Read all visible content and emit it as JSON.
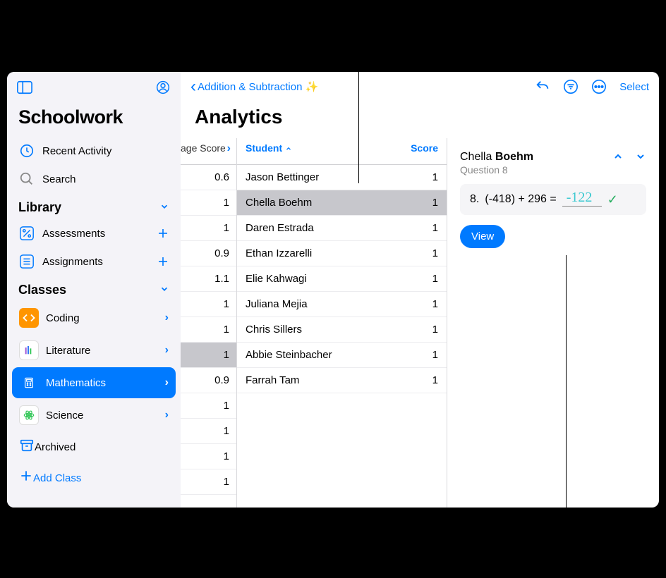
{
  "sidebar": {
    "title": "Schoolwork",
    "recent": "Recent Activity",
    "search": "Search",
    "library_header": "Library",
    "assessments": "Assessments",
    "assignments": "Assignments",
    "classes_header": "Classes",
    "classes": {
      "coding": "Coding",
      "literature": "Literature",
      "mathematics": "Mathematics",
      "science": "Science",
      "archived": "Archived"
    },
    "add_class": "Add Class"
  },
  "toolbar": {
    "back_label": "Addition & Subtraction ✨",
    "select": "Select"
  },
  "main": {
    "title": "Analytics"
  },
  "avg": {
    "header": "age Score",
    "values": [
      "0.6",
      "1",
      "1",
      "0.9",
      "1.1",
      "1",
      "1",
      "1",
      "0.9",
      "1",
      "1",
      "1",
      "1"
    ]
  },
  "students": {
    "header_left": "Student",
    "header_right": "Score",
    "list": [
      {
        "name": "Jason Bettinger",
        "score": "1"
      },
      {
        "name": "Chella Boehm",
        "score": "1"
      },
      {
        "name": "Daren Estrada",
        "score": "1"
      },
      {
        "name": "Ethan Izzarelli",
        "score": "1"
      },
      {
        "name": "Elie Kahwagi",
        "score": "1"
      },
      {
        "name": "Juliana Mejia",
        "score": "1"
      },
      {
        "name": "Chris Sillers",
        "score": "1"
      },
      {
        "name": "Abbie Steinbacher",
        "score": "1"
      },
      {
        "name": "Farrah Tam",
        "score": "1"
      }
    ],
    "selected_index": 1
  },
  "detail": {
    "name_first": "Chella",
    "name_last": "Boehm",
    "question_label": "Question 8",
    "q_number": "8.",
    "q_text": "(-418) + 296 =",
    "answer": "-122",
    "view_label": "View"
  }
}
